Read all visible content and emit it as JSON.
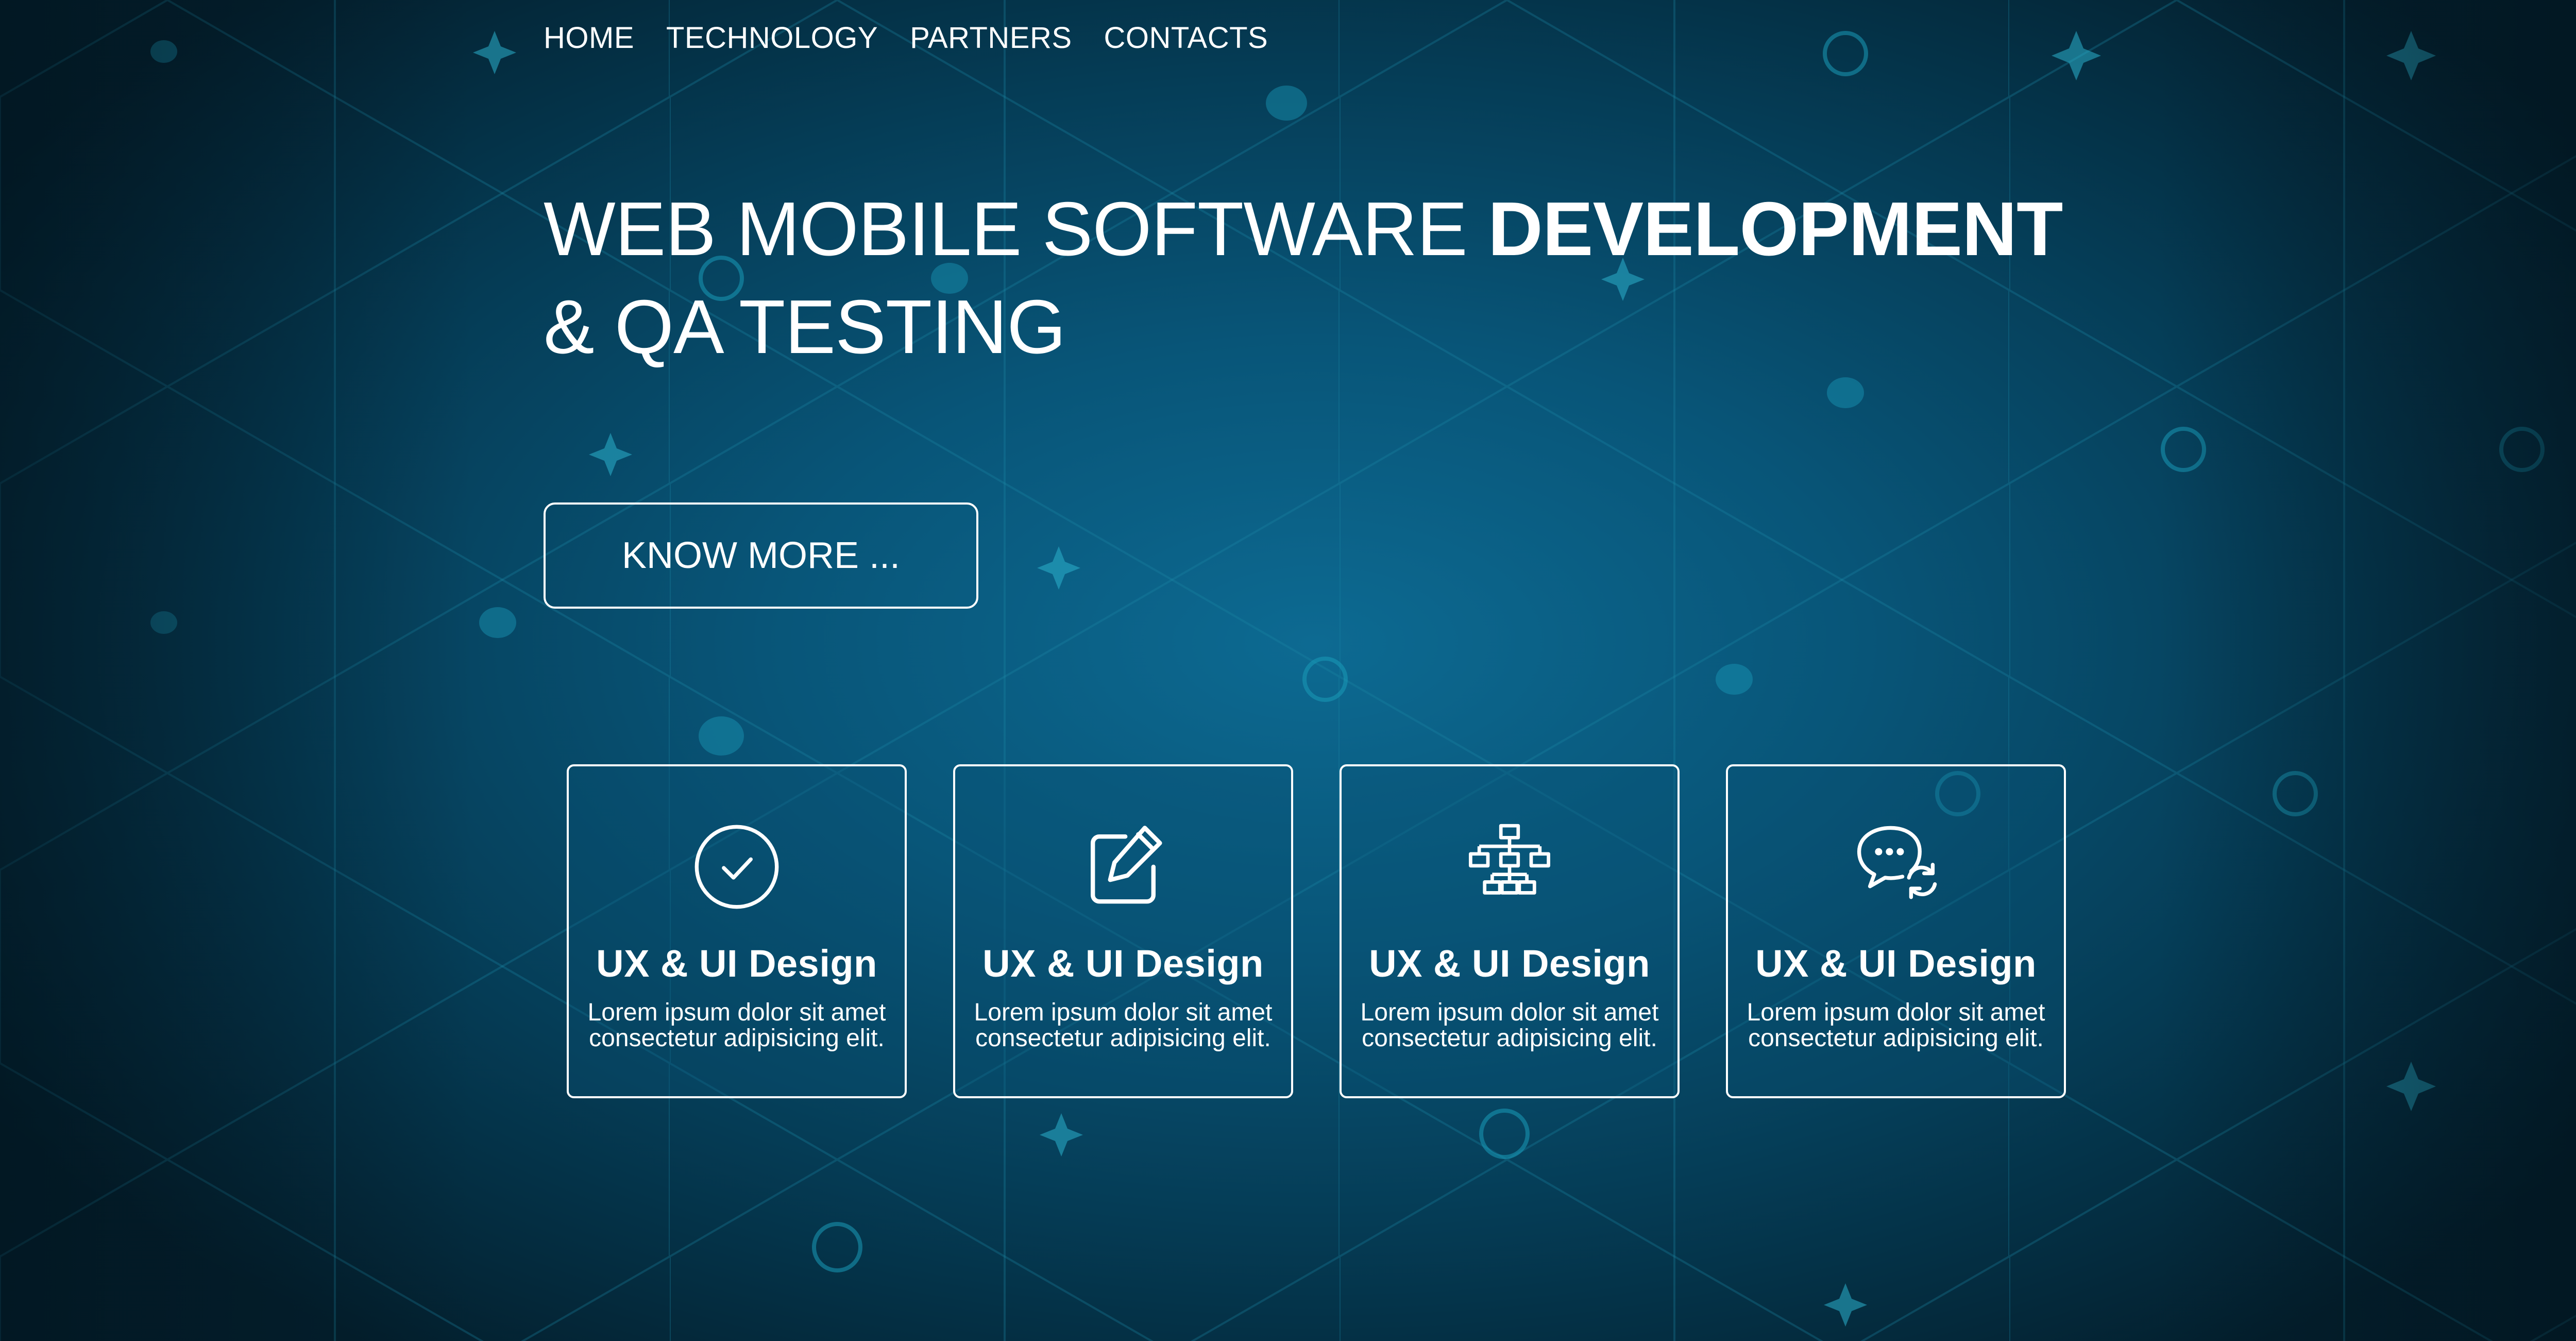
{
  "nav": {
    "items": [
      "HOME",
      "TECHNOLOGY",
      "PARTNERS",
      "CONTACTS"
    ]
  },
  "hero": {
    "title_regular": "WEB MOBILE SOFTWARE ",
    "title_bold": "DEVELOPMENT",
    "title_line2": "& QA TESTING",
    "button_label": "KNOW MORE ..."
  },
  "cards": [
    {
      "icon": "check-circle-icon",
      "title": "UX & UI Design",
      "text_line1": "Lorem ipsum dolor sit amet",
      "text_line2": "consectetur adipisicing elit."
    },
    {
      "icon": "edit-icon",
      "title": "UX & UI Design",
      "text_line1": "Lorem ipsum dolor sit amet",
      "text_line2": "consectetur adipisicing elit."
    },
    {
      "icon": "sitemap-icon",
      "title": "UX & UI Design",
      "text_line1": "Lorem ipsum dolor sit amet",
      "text_line2": "consectetur adipisicing elit."
    },
    {
      "icon": "chat-sync-icon",
      "title": "UX & UI Design",
      "text_line1": "Lorem ipsum dolor sit amet",
      "text_line2": "consectetur adipisicing elit."
    }
  ],
  "colors": {
    "background_center": "#0d6a92",
    "background_edge": "#031f2d",
    "pattern_line": "#1a8aa8",
    "text": "#ffffff"
  }
}
